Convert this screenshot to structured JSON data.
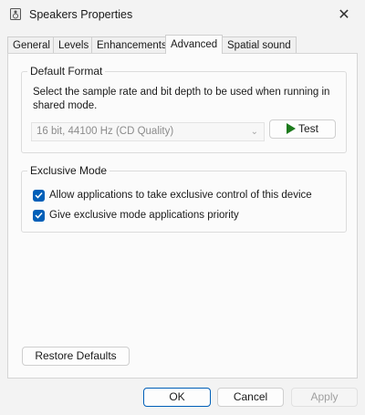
{
  "window": {
    "title": "Speakers Properties",
    "close_glyph": "✕"
  },
  "tabs": [
    {
      "label": "General"
    },
    {
      "label": "Levels"
    },
    {
      "label": "Enhancements"
    },
    {
      "label": "Advanced",
      "active": true
    },
    {
      "label": "Spatial sound"
    }
  ],
  "default_format": {
    "title": "Default Format",
    "description": "Select the sample rate and bit depth to be used when running in shared mode.",
    "selected_format": "16 bit, 44100 Hz (CD Quality)",
    "test_label": "Test"
  },
  "exclusive_mode": {
    "title": "Exclusive Mode",
    "options": [
      {
        "label": "Allow applications to take exclusive control of this device",
        "checked": true
      },
      {
        "label": "Give exclusive mode applications priority",
        "checked": true
      }
    ]
  },
  "restore_defaults_label": "Restore Defaults",
  "footer": {
    "ok_label": "OK",
    "cancel_label": "Cancel",
    "apply_label": "Apply"
  },
  "colors": {
    "accent": "#005fb8",
    "play_icon": "#1c7a1c"
  }
}
